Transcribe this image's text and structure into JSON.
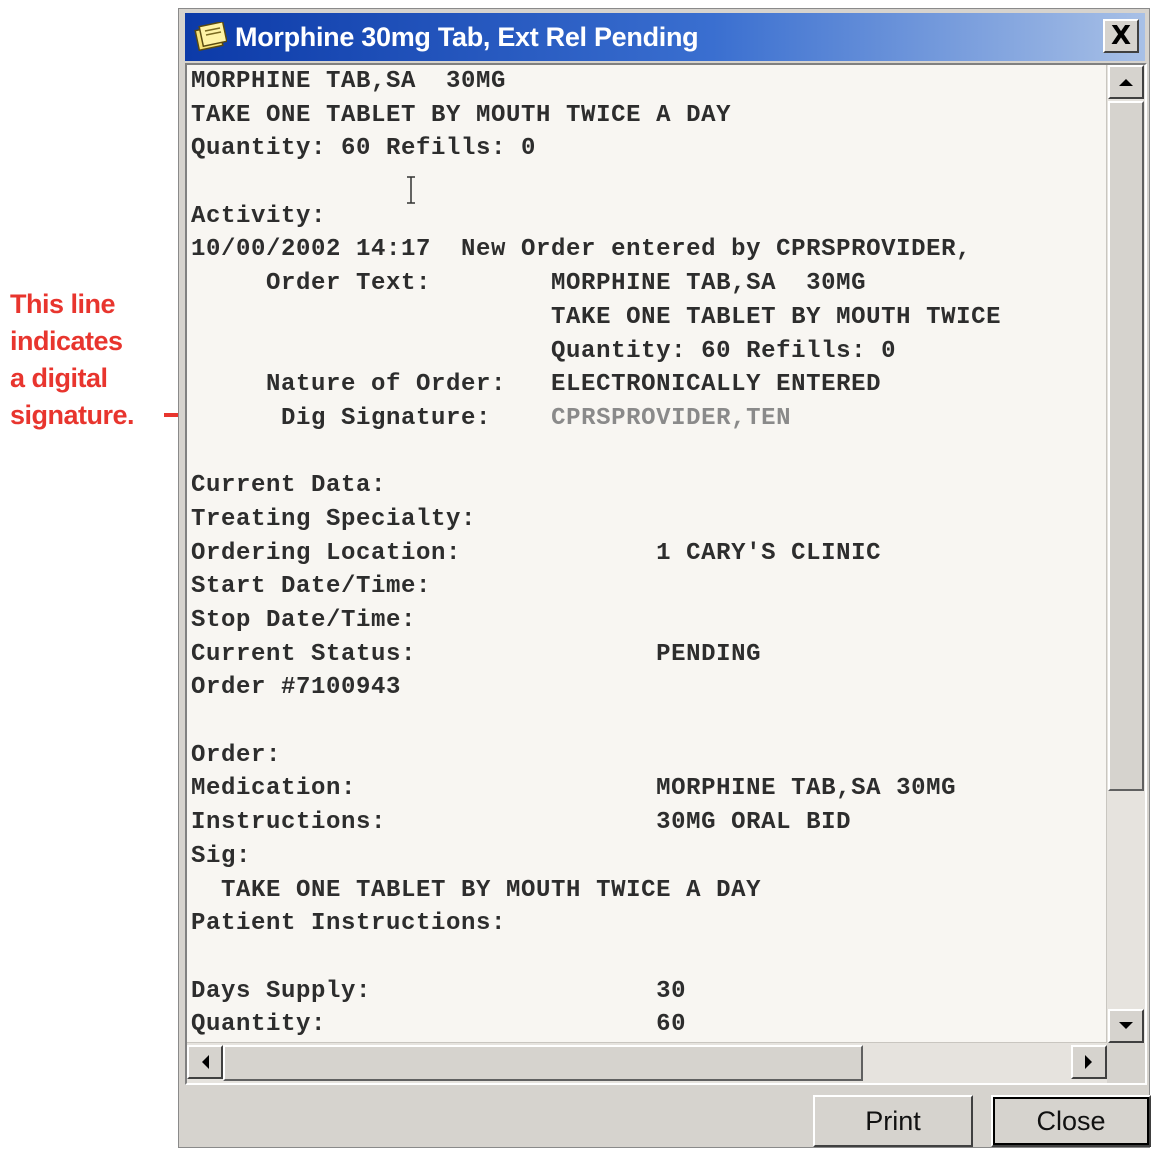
{
  "annotation": {
    "lines": [
      "This line",
      "indicates",
      "a digital",
      "signature."
    ],
    "color": "#e8352e"
  },
  "window": {
    "title": "Morphine 30mg Tab, Ext Rel Pending",
    "icon": "notepad-icon",
    "close_symbol": "X"
  },
  "report_lines": [
    {
      "text": "MORPHINE TAB,SA  30MG",
      "style": "normal"
    },
    {
      "text": "TAKE ONE TABLET BY MOUTH TWICE A DAY",
      "style": "normal"
    },
    {
      "text": "Quantity: 60 Refills: 0",
      "style": "normal"
    },
    {
      "text": "",
      "style": "normal"
    },
    {
      "text": "Activity:",
      "style": "normal"
    },
    {
      "text": "10/00/2002 14:17  New Order entered by CPRSPROVIDER,",
      "style": "normal"
    },
    {
      "text": "     Order Text:        MORPHINE TAB,SA  30MG",
      "style": "normal"
    },
    {
      "text": "                        TAKE ONE TABLET BY MOUTH TWICE",
      "style": "normal"
    },
    {
      "text": "                        Quantity: 60 Refills: 0",
      "style": "normal"
    },
    {
      "text": "     Nature of Order:   ELECTRONICALLY ENTERED",
      "style": "normal"
    },
    {
      "text": "      Dig Signature:    ",
      "style": "normal",
      "suffix": "CPRSPROVIDER,TEN"
    },
    {
      "text": "",
      "style": "normal"
    },
    {
      "text": "Current Data:",
      "style": "normal"
    },
    {
      "text": "Treating Specialty:",
      "style": "normal"
    },
    {
      "text": "Ordering Location:             1 CARY'S CLINIC",
      "style": "normal"
    },
    {
      "text": "Start Date/Time:",
      "style": "normal"
    },
    {
      "text": "Stop Date/Time:",
      "style": "normal"
    },
    {
      "text": "Current Status:                PENDING",
      "style": "normal"
    },
    {
      "text": "Order #7100943",
      "style": "normal"
    },
    {
      "text": "",
      "style": "normal"
    },
    {
      "text": "Order:",
      "style": "normal"
    },
    {
      "text": "Medication:                    MORPHINE TAB,SA 30MG",
      "style": "normal"
    },
    {
      "text": "Instructions:                  30MG ORAL BID",
      "style": "normal"
    },
    {
      "text": "Sig:",
      "style": "normal"
    },
    {
      "text": "  TAKE ONE TABLET BY MOUTH TWICE A DAY",
      "style": "normal"
    },
    {
      "text": "Patient Instructions:",
      "style": "normal"
    },
    {
      "text": "",
      "style": "normal"
    },
    {
      "text": "Days Supply:                   30",
      "style": "normal"
    },
    {
      "text": "Quantity:                      60",
      "style": "normal"
    }
  ],
  "buttons": {
    "print_label": "Print",
    "close_label": "Close"
  },
  "icons": {
    "scroll_up": "up-arrow-icon",
    "scroll_down": "down-arrow-icon",
    "scroll_left": "left-arrow-icon",
    "scroll_right": "right-arrow-icon",
    "text_cursor": "ibeam-cursor-icon"
  }
}
